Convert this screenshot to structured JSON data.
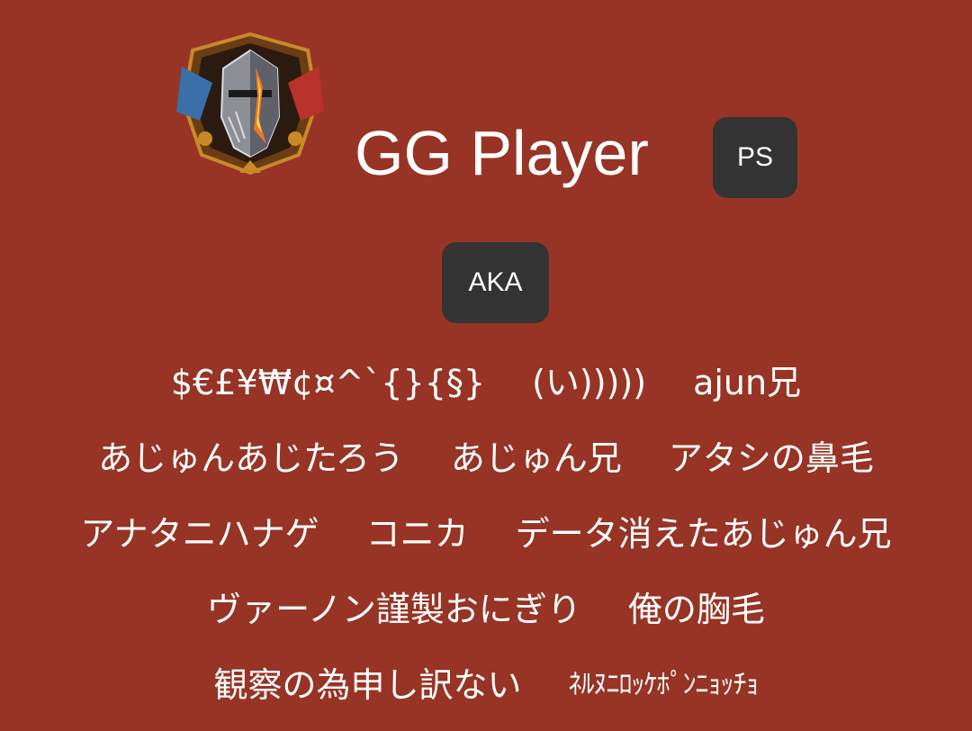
{
  "profile": {
    "name": "GG Player",
    "platform_badge": "PS",
    "emblem_icon": "knight-helmet-emblem-icon"
  },
  "aka": {
    "label": "AKA",
    "rows": [
      [
        "$€£¥₩¢¤^`{}{§}",
        "(い)))))",
        "ajun兄"
      ],
      [
        "あじゅんあじたろう",
        "あじゅん兄",
        "アタシの鼻毛"
      ],
      [
        "アナタニハナゲ",
        "コニカ",
        "データ消えたあじゅん兄"
      ],
      [
        "ヴァーノン謹製おにぎり",
        "俺の胸毛"
      ],
      [
        "観察の為申し訳ない",
        "ﾈﾙﾇﾆﾛｯｹﾎﾟﾝﾆｮｯﾁｮ"
      ]
    ]
  },
  "colors": {
    "background": "#973425",
    "badge": "#333333",
    "text": "#ffffff"
  }
}
